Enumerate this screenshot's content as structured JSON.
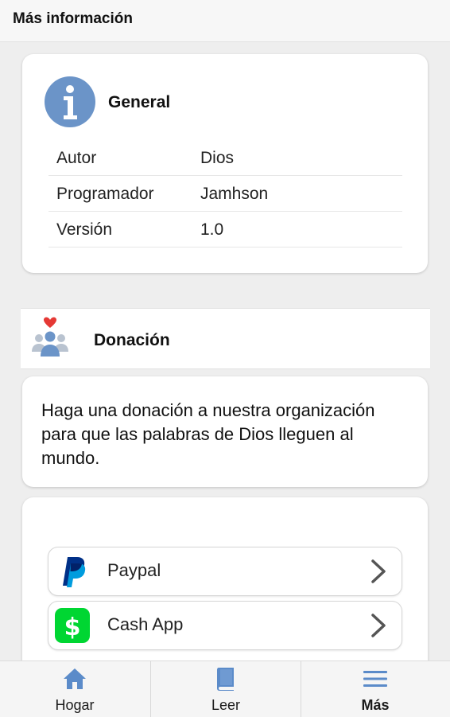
{
  "header": {
    "title": "Más información"
  },
  "general": {
    "heading": "General",
    "icon": "info-icon",
    "rows": [
      {
        "key": "Autor",
        "value": "Dios"
      },
      {
        "key": "Programador",
        "value": "Jamhson"
      },
      {
        "key": "Versión",
        "value": "1.0"
      }
    ]
  },
  "donation": {
    "heading": "Donación",
    "icon": "donation-people-heart-icon",
    "description": "Haga una donación a nuestra organización para que las palabras de Dios lleguen al mundo.",
    "options": [
      {
        "label": "Paypal",
        "icon": "paypal-logo-icon"
      },
      {
        "label": "Cash App",
        "icon": "cashapp-logo-icon"
      }
    ]
  },
  "nav": {
    "items": [
      {
        "label": "Hogar",
        "icon": "home-icon"
      },
      {
        "label": "Leer",
        "icon": "book-icon"
      },
      {
        "label": "Más",
        "icon": "menu-icon",
        "active": true
      }
    ]
  },
  "colors": {
    "accent": "#5b8bc9",
    "info_icon": "#6b94c8",
    "heart": "#e53935",
    "paypal_dark": "#003087",
    "paypal_light": "#009cde",
    "cashapp": "#00d632"
  }
}
